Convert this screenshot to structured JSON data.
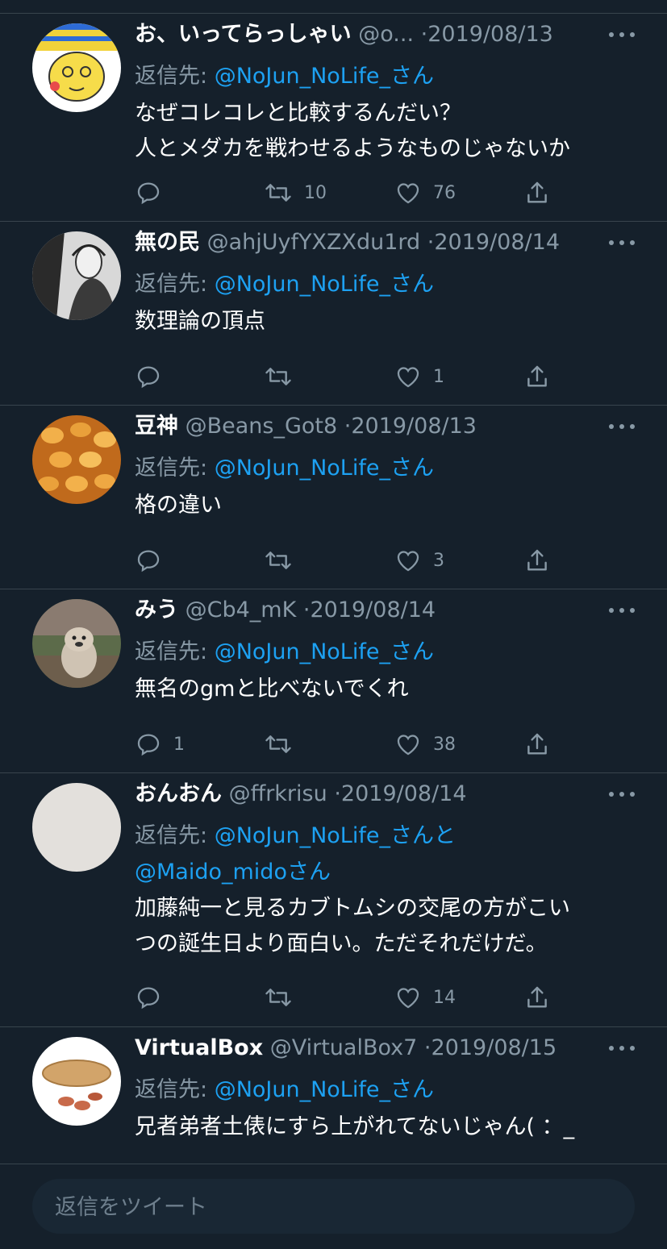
{
  "reply_prefix": "返信先: ",
  "tweets": [
    {
      "name": "お、いってらっしゃい",
      "handle": "@o...",
      "date": "2019/08/13",
      "mention": "@NoJun_NoLife_",
      "mention_suffix": "さん",
      "text_lines": [
        "なぜコレコレと比較するんだい？",
        "人とメダカを戦わせるようなものじゃないか"
      ],
      "replies": "",
      "retweets": "10",
      "likes": "76"
    },
    {
      "name": "無の民",
      "handle": "@ahjUyfYXZXdu1rd",
      "date": "2019/08/14",
      "mention": "@NoJun_NoLife_",
      "mention_suffix": "さん",
      "text_lines": [
        "数理論の頂点"
      ],
      "replies": "",
      "retweets": "",
      "likes": "1"
    },
    {
      "name": "豆神",
      "handle": "@Beans_Got8",
      "date": "2019/08/13",
      "mention": "@NoJun_NoLife_",
      "mention_suffix": "さん",
      "text_lines": [
        "格の違い"
      ],
      "replies": "",
      "retweets": "",
      "likes": "3"
    },
    {
      "name": "みう",
      "handle": "@Cb4_mK",
      "date": "2019/08/14",
      "mention": "@NoJun_NoLife_",
      "mention_suffix": "さん",
      "text_lines": [
        "無名のgmと比べないでくれ"
      ],
      "replies": "1",
      "retweets": "",
      "likes": "38"
    },
    {
      "name": "おんおん",
      "handle": "@ffrkrisu",
      "date": "2019/08/14",
      "mention": "@NoJun_NoLife_",
      "mention_suffix": "さんと",
      "mention2": "@Maido_mido",
      "mention2_suffix": "さん",
      "text_lines": [
        "加藤純一と見るカブトムシの交尾の方がこい",
        "つの誕生日より面白い。ただそれだけだ。"
      ],
      "replies": "",
      "retweets": "",
      "likes": "14"
    },
    {
      "name": "VirtualBox",
      "handle": "@VirtualBox7",
      "date": "2019/08/15",
      "mention": "@NoJun_NoLife_",
      "mention_suffix": "さん",
      "text_lines": [
        "兄者弟者土俵にすら上がれてないじゃん(  ：_"
      ]
    }
  ],
  "composer": {
    "placeholder": "返信をツイート"
  },
  "colors": {
    "background": "#15202b",
    "accent": "#1da1f2",
    "muted": "#8899a6",
    "divider": "#38444d"
  }
}
